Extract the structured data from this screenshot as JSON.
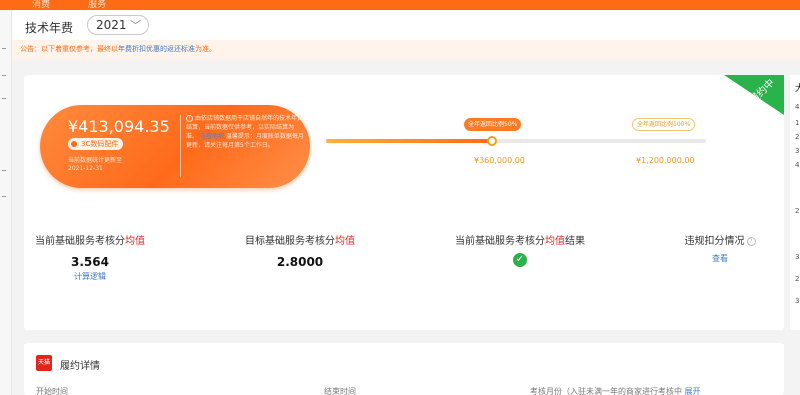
{
  "topnav": {
    "item1": "消费",
    "item2": "服务"
  },
  "filter": {
    "label": "技术年费",
    "year": "2021"
  },
  "notice": {
    "prefix": "公告：以下着重仅参考，最终以",
    "highlight": "年费折扣优惠的返还标准",
    "suffix": "为准。"
  },
  "summary": {
    "amount": "¥413,094.35",
    "category": "3C数码配件",
    "note_line1": "当前数据统计更新至",
    "note_line2": "2021-12-31",
    "info_text": "由依店铺数据用于店铺自然年的技术年费结算，当前数据仅供参考，以实际结算为准。",
    "info_link": "查看明细",
    "info_text2": "温馨提示：月度账单数据每月更新，请关注每月第5个工作日。"
  },
  "progress": {
    "milestones": [
      {
        "label": "全年返回比例50%",
        "amount": "¥360,000.00"
      },
      {
        "label": "全年返回比例100%",
        "amount": "¥1,200,000.00"
      }
    ],
    "fill_fraction": 0.44
  },
  "status_ribbon": "履约中",
  "metrics": {
    "current": {
      "title": "当前基础服务考核分",
      "title_red": "均值",
      "value": "3.564",
      "link": "计算逻辑"
    },
    "target": {
      "title": "目标基础服务考核分",
      "title_red": "均值",
      "value": "2.8000"
    },
    "result": {
      "title_a": "当前基础服务考核分",
      "title_red": "均值",
      "title_b": "结果"
    },
    "violation": {
      "title": "违规扣分情况",
      "link": "查看"
    }
  },
  "detail": {
    "badge": "天猫",
    "title": "履约详情",
    "col1": "开始时间",
    "col2": "结束时间",
    "col3": "考核月份（入驻未满一年的商家进行考核中",
    "expand": "展开"
  },
  "right_sliver": [
    "大",
    "4",
    "1",
    "2",
    "3",
    "4",
    "2",
    "3",
    "2",
    "3"
  ],
  "colors": {
    "brand_orange": "#ff6a14",
    "success_green": "#2ab34a",
    "link_blue": "#3f79c4",
    "accent_red": "#e1251b"
  }
}
